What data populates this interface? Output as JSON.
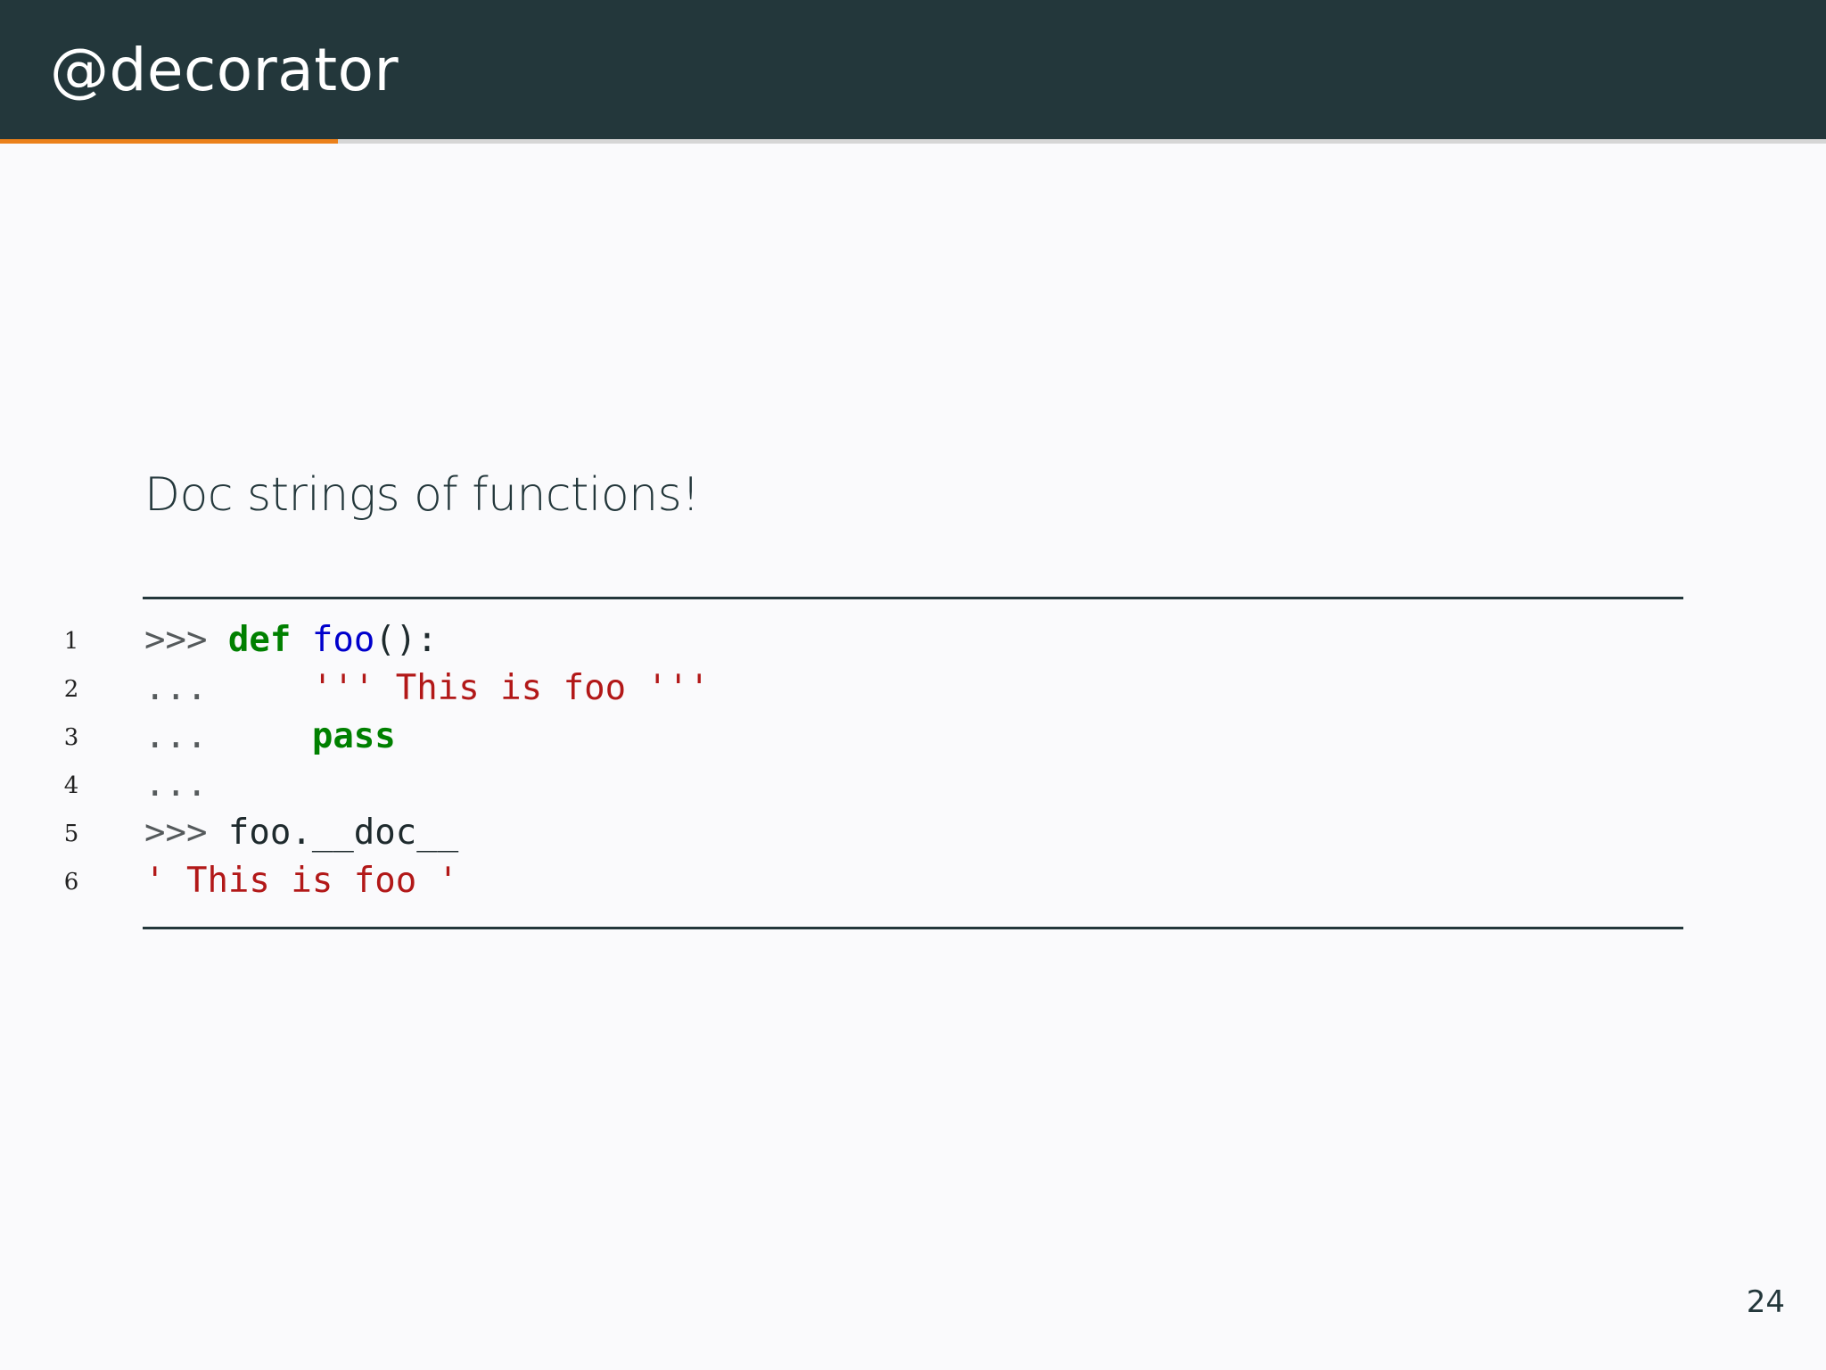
{
  "header": {
    "title": "@decorator"
  },
  "progress": {
    "fraction": 0.185,
    "fill_color": "#eb811b",
    "track_color": "#d6d6d6"
  },
  "colors": {
    "header_bg": "#23373b",
    "slide_bg": "#fafafc",
    "keyword": "#008000",
    "function_name": "#0000cc",
    "string": "#b21818"
  },
  "content": {
    "subtitle": "Doc strings of functions!"
  },
  "code": {
    "lines": [
      {
        "number": "1",
        "tokens": [
          {
            "text": ">>> ",
            "kind": "prompt"
          },
          {
            "text": "def",
            "kind": "kw"
          },
          {
            "text": " ",
            "kind": "plain"
          },
          {
            "text": "foo",
            "kind": "fn"
          },
          {
            "text": "():",
            "kind": "plain"
          }
        ]
      },
      {
        "number": "2",
        "tokens": [
          {
            "text": "...     ",
            "kind": "prompt"
          },
          {
            "text": "''' This is foo '''",
            "kind": "str"
          }
        ]
      },
      {
        "number": "3",
        "tokens": [
          {
            "text": "...     ",
            "kind": "prompt"
          },
          {
            "text": "pass",
            "kind": "kw"
          }
        ]
      },
      {
        "number": "4",
        "tokens": [
          {
            "text": "...",
            "kind": "prompt"
          }
        ]
      },
      {
        "number": "5",
        "tokens": [
          {
            "text": ">>> ",
            "kind": "prompt"
          },
          {
            "text": "foo.__doc__",
            "kind": "plain"
          }
        ]
      },
      {
        "number": "6",
        "tokens": [
          {
            "text": "' This is foo '",
            "kind": "str"
          }
        ]
      }
    ]
  },
  "footer": {
    "page_number": "24"
  }
}
